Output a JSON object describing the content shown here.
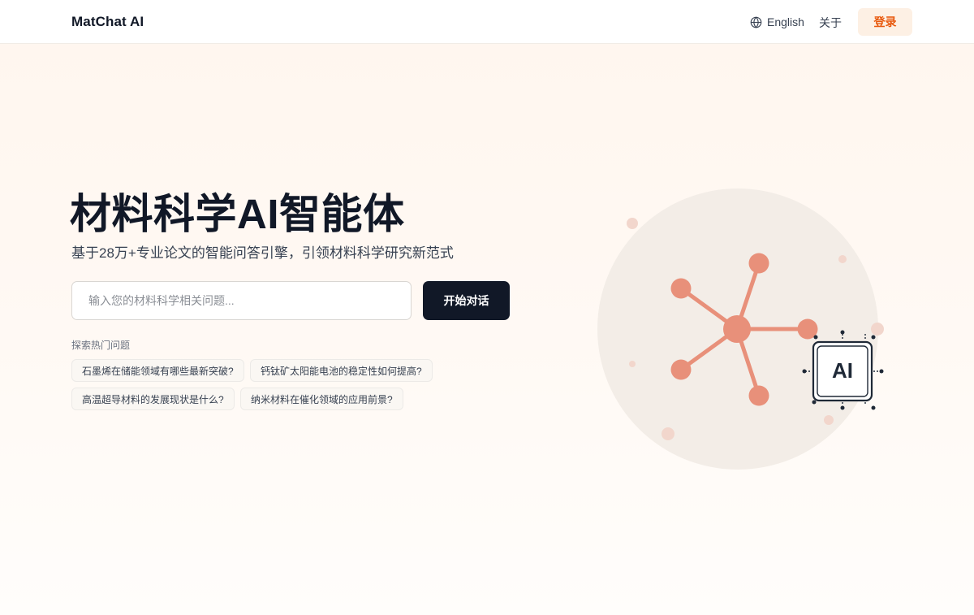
{
  "header": {
    "brand": "MatChat AI",
    "language_label": "English",
    "about_label": "关于",
    "login_label": "登录"
  },
  "hero": {
    "title": "材料科学AI智能体",
    "subtitle": "基于28万+专业论文的智能问答引擎，引领材料科学研究新范式"
  },
  "search": {
    "placeholder": "输入您的材料科学相关问题...",
    "value": "",
    "button_label": "开始对话"
  },
  "explore": {
    "label": "探索热门问题",
    "questions": [
      "石墨烯在储能领域有哪些最新突破?",
      "钙钛矿太阳能电池的稳定性如何提高?",
      "高温超导材料的发展现状是什么?",
      "纳米材料在催化领域的应用前景?"
    ]
  },
  "illustration": {
    "chip_label": "AI",
    "icons": [
      "molecule-network-icon",
      "ai-chip-icon"
    ]
  },
  "colors": {
    "accent": "#e8580c",
    "accent_bg": "#fdf0e4",
    "dark_button": "#111827",
    "node": "#e8907a",
    "circle_bg": "#f3ede7"
  }
}
